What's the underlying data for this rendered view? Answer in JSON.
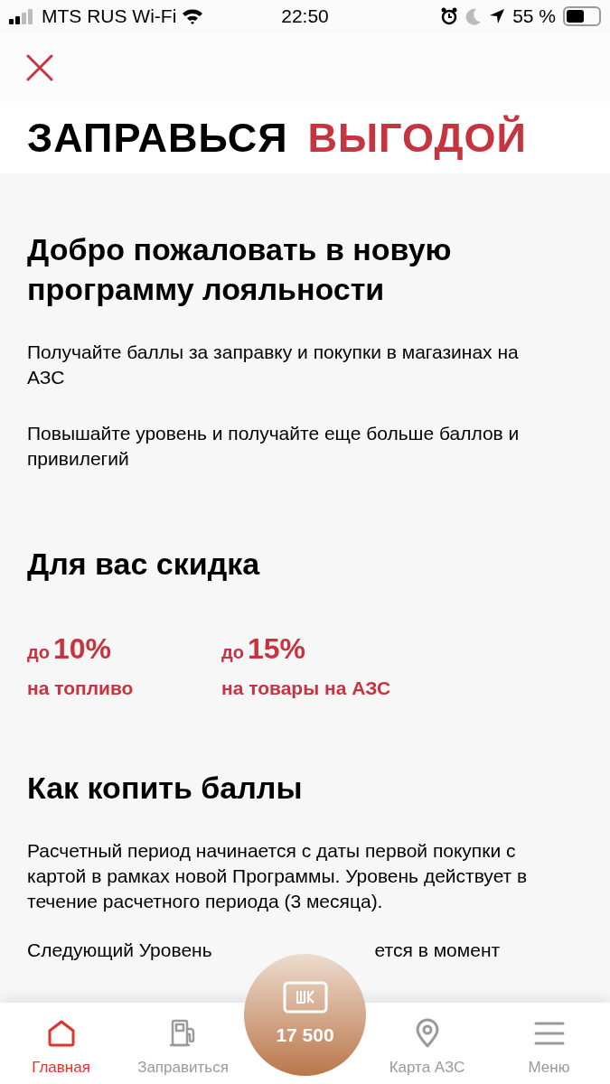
{
  "status_bar": {
    "carrier": "MTS RUS Wi-Fi",
    "time": "22:50",
    "battery": "55 %"
  },
  "logo": {
    "first": "ЗАПРАВЬСЯ",
    "second": "ВЫГОДОЙ"
  },
  "welcome": {
    "title": "Добро пожаловать в новую программу лояльности",
    "paragraphs": [
      "Получайте баллы за заправку и покупки в магазинах на АЗС",
      "Повышайте уровень и получайте еще больше баллов и привилегий"
    ]
  },
  "discount": {
    "title": "Для вас скидка",
    "items": [
      {
        "prefix": "до",
        "value": "10%",
        "caption": "на топливо"
      },
      {
        "prefix": "до",
        "value": "15%",
        "caption": "на товары на АЗС"
      }
    ]
  },
  "points": {
    "title": "Как копить баллы",
    "paragraph": "Расчетный период начинается с даты первой покупки с картой в рамках новой Программы. Уровень действует в течение расчетного периода (3 месяца).",
    "cut_text": [
      "Следующий Уровень",
      "ется в момент"
    ]
  },
  "nav": {
    "items": [
      {
        "kind": "home",
        "label": "Главная",
        "selected": true
      },
      {
        "kind": "fuel",
        "label": "Заправиться",
        "selected": false
      },
      {
        "kind": "card",
        "label": "17 500",
        "selected": false
      },
      {
        "kind": "map",
        "label": "Карта АЗС",
        "selected": false
      },
      {
        "kind": "menu",
        "label": "Меню",
        "selected": false
      }
    ]
  }
}
